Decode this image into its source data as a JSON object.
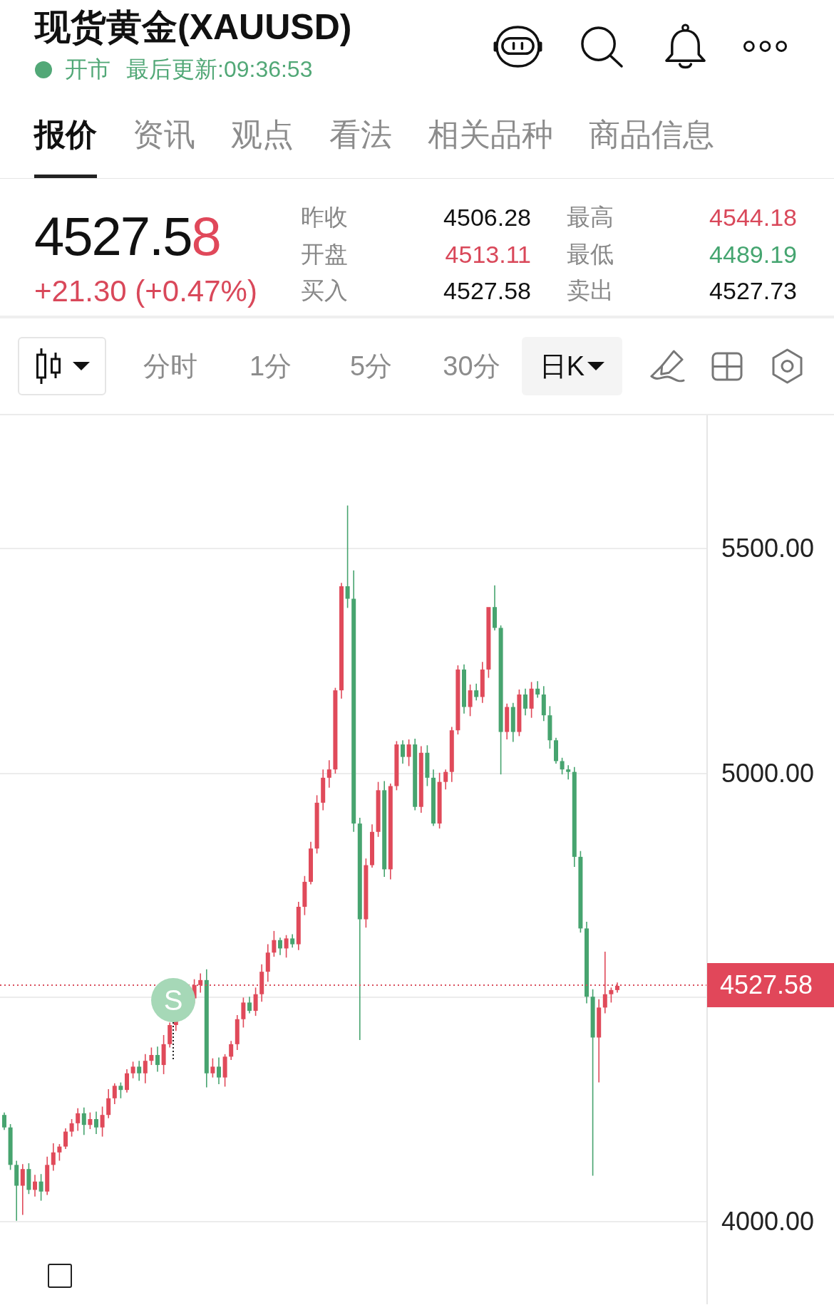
{
  "header": {
    "title": "现货黄金(XAUUSD)",
    "status": {
      "open": true,
      "label": "开市",
      "updated": "最后更新:09:36:53"
    }
  },
  "tabs": [
    {
      "label": "报价",
      "selected": true
    },
    {
      "label": "资讯",
      "selected": false
    },
    {
      "label": "观点",
      "selected": false
    },
    {
      "label": "看法",
      "selected": false
    },
    {
      "label": "相关品种",
      "selected": false
    },
    {
      "label": "商品信息",
      "selected": false
    }
  ],
  "quote": {
    "price_parts": [
      {
        "text": "4527.5",
        "changed": false
      },
      {
        "text": "8",
        "changed": true
      }
    ],
    "change": {
      "text": "+21.30 (+0.47%)",
      "color": "#d9485a"
    },
    "stats": [
      {
        "label": "昨收",
        "value": "4506.28",
        "color": "#111111"
      },
      {
        "label": "最高",
        "value": "4544.18",
        "color": "#d9485a"
      },
      {
        "label": "开盘",
        "value": "4513.11",
        "color": "#d9485a"
      },
      {
        "label": "最低",
        "value": "4489.19",
        "color": "#45a570"
      },
      {
        "label": "买入",
        "value": "4527.58",
        "color": "#111111"
      },
      {
        "label": "卖出",
        "value": "4527.73",
        "color": "#111111"
      }
    ]
  },
  "toolbar": {
    "periods": [
      {
        "label": "分时",
        "kind": "plain",
        "selected": false
      },
      {
        "label": "1分",
        "kind": "plain",
        "selected": false
      },
      {
        "label": "5分",
        "kind": "plain",
        "selected": false
      },
      {
        "label": "30分",
        "kind": "plain",
        "selected": false
      },
      {
        "label": "日K",
        "kind": "dropdown",
        "selected": true
      }
    ]
  },
  "chart": {
    "y_axis_labels": [
      "5500.00",
      "5000.00",
      "4000.00"
    ],
    "price_tag": "4527.58",
    "signal_marker": "S"
  }
}
